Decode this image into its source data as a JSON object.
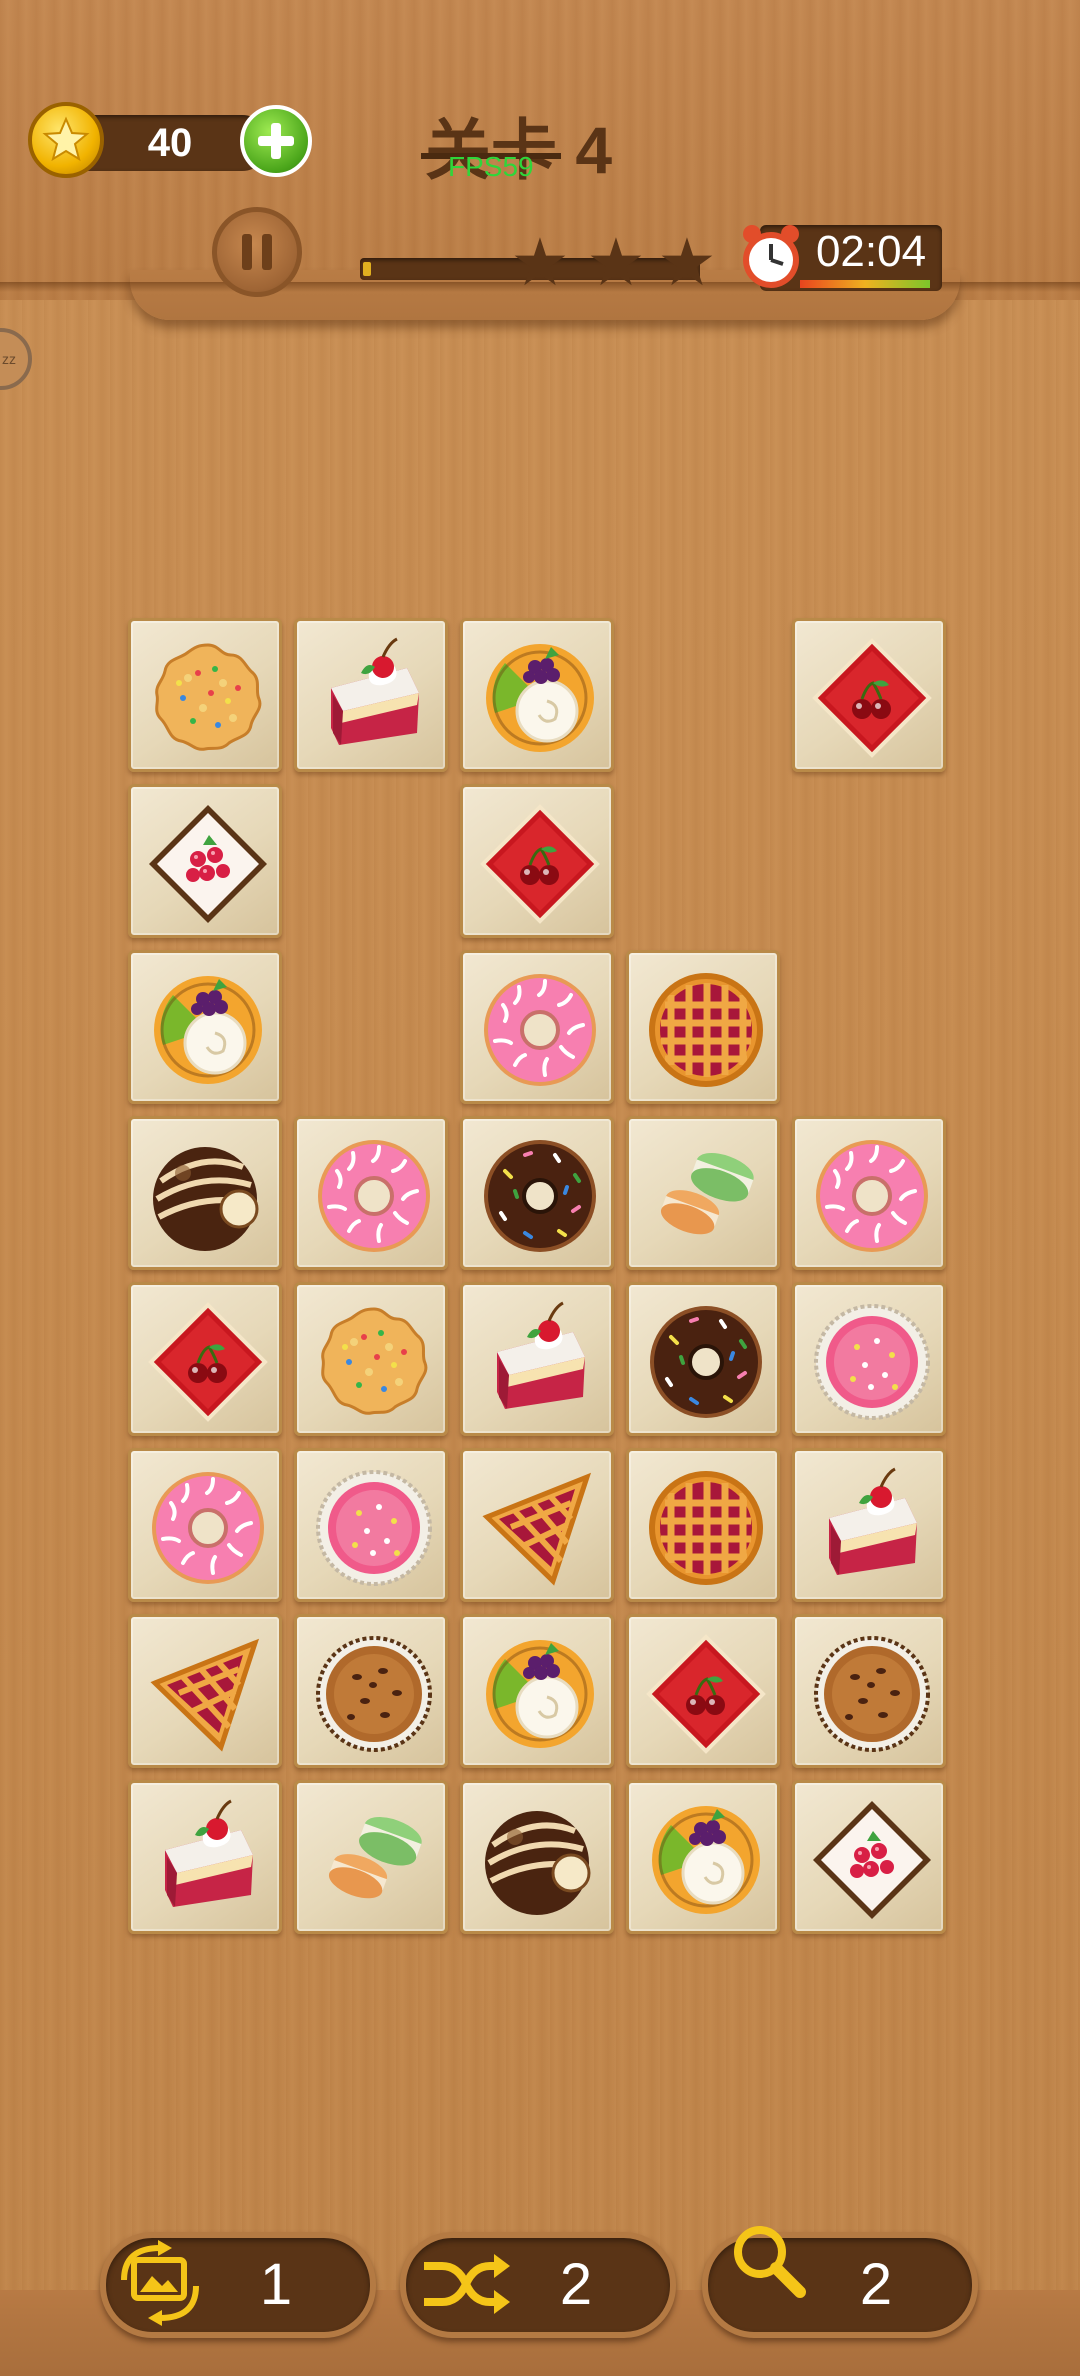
{
  "hud": {
    "coins": "40",
    "level_label": "关卡",
    "level_number": "4",
    "fps": "FPS59",
    "timer": "02:04",
    "stars_earned_of": 3,
    "progress_fraction": 0.02
  },
  "side_button": {
    "label": "zz"
  },
  "board": {
    "tiles": [
      {
        "row": 0,
        "col": 0,
        "item": "cookie"
      },
      {
        "row": 0,
        "col": 1,
        "item": "cake-slice"
      },
      {
        "row": 0,
        "col": 2,
        "item": "fruit-tart"
      },
      {
        "row": 0,
        "col": 4,
        "item": "cherry-diamond"
      },
      {
        "row": 1,
        "col": 0,
        "item": "raspberry-diamond"
      },
      {
        "row": 1,
        "col": 2,
        "item": "cherry-diamond"
      },
      {
        "row": 2,
        "col": 0,
        "item": "fruit-tart"
      },
      {
        "row": 2,
        "col": 2,
        "item": "pink-donut"
      },
      {
        "row": 2,
        "col": 3,
        "item": "lattice-pie"
      },
      {
        "row": 3,
        "col": 0,
        "item": "chocolate-truffle"
      },
      {
        "row": 3,
        "col": 1,
        "item": "pink-donut"
      },
      {
        "row": 3,
        "col": 2,
        "item": "chocolate-donut"
      },
      {
        "row": 3,
        "col": 3,
        "item": "macarons"
      },
      {
        "row": 3,
        "col": 4,
        "item": "pink-donut"
      },
      {
        "row": 4,
        "col": 0,
        "item": "cherry-diamond"
      },
      {
        "row": 4,
        "col": 1,
        "item": "cookie"
      },
      {
        "row": 4,
        "col": 2,
        "item": "cake-slice"
      },
      {
        "row": 4,
        "col": 3,
        "item": "chocolate-donut"
      },
      {
        "row": 4,
        "col": 4,
        "item": "pink-cupcake"
      },
      {
        "row": 5,
        "col": 0,
        "item": "pink-donut"
      },
      {
        "row": 5,
        "col": 1,
        "item": "pink-cupcake"
      },
      {
        "row": 5,
        "col": 2,
        "item": "pie-slice"
      },
      {
        "row": 5,
        "col": 3,
        "item": "lattice-pie"
      },
      {
        "row": 5,
        "col": 4,
        "item": "cake-slice"
      },
      {
        "row": 6,
        "col": 0,
        "item": "pie-slice"
      },
      {
        "row": 6,
        "col": 1,
        "item": "chocolate-chip-muffin"
      },
      {
        "row": 6,
        "col": 2,
        "item": "fruit-tart"
      },
      {
        "row": 6,
        "col": 3,
        "item": "cherry-diamond"
      },
      {
        "row": 6,
        "col": 4,
        "item": "chocolate-chip-muffin"
      },
      {
        "row": 7,
        "col": 0,
        "item": "cake-slice"
      },
      {
        "row": 7,
        "col": 1,
        "item": "macarons"
      },
      {
        "row": 7,
        "col": 2,
        "item": "chocolate-truffle"
      },
      {
        "row": 7,
        "col": 3,
        "item": "fruit-tart"
      },
      {
        "row": 7,
        "col": 4,
        "item": "raspberry-diamond"
      }
    ]
  },
  "toolbar": {
    "refresh": {
      "count": "1",
      "icon": "image-refresh-icon"
    },
    "shuffle": {
      "count": "2",
      "icon": "shuffle-icon"
    },
    "hint": {
      "count": "2",
      "icon": "magnifier-icon"
    }
  },
  "colors": {
    "wood": "#c58a4f",
    "dark_wood": "#5a3416",
    "tile_face": "#efe3c8",
    "tile_border": "#b98a48",
    "fps_green": "#2fd63a"
  }
}
